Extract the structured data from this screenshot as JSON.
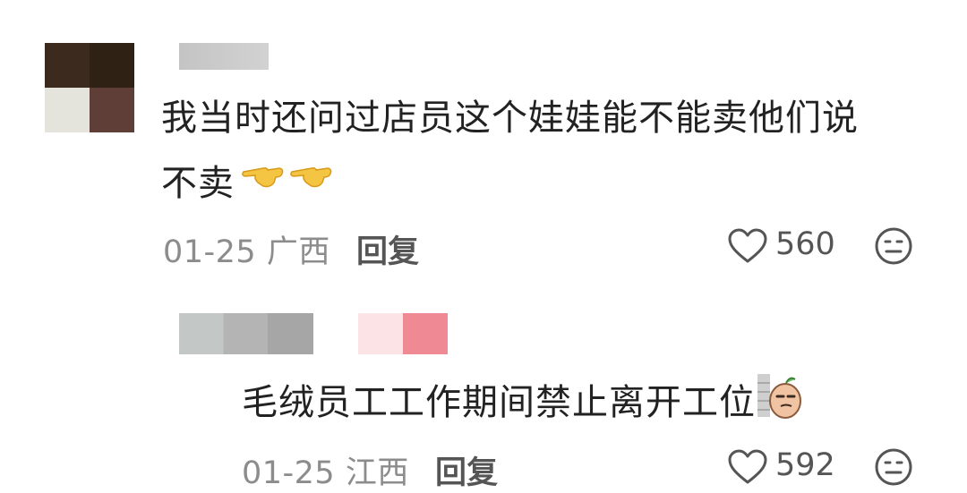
{
  "comments": [
    {
      "text_line1": "我当时还问过店员这个娃娃能不能卖他们说",
      "text_line2": "不卖",
      "emojis": [
        "backhand-index-pointing-left-icon",
        "backhand-index-pointing-left-icon"
      ],
      "date": "01-25",
      "location": "广西",
      "reply_label": "回复",
      "likes": "560",
      "avatar_colors": [
        "#3d2a1f",
        "#2f2113",
        "#e4e4dc",
        "#5e3e36"
      ]
    }
  ],
  "replies": [
    {
      "text": "毛绒员工工作期间禁止离开工位",
      "sticker": "potato-peeking-sticker-icon",
      "date": "01-25",
      "location": "江西",
      "reply_label": "回复",
      "likes": "592"
    }
  ],
  "colors": {
    "text": "#222222",
    "meta": "#8c8c8c",
    "icon": "#555555"
  }
}
